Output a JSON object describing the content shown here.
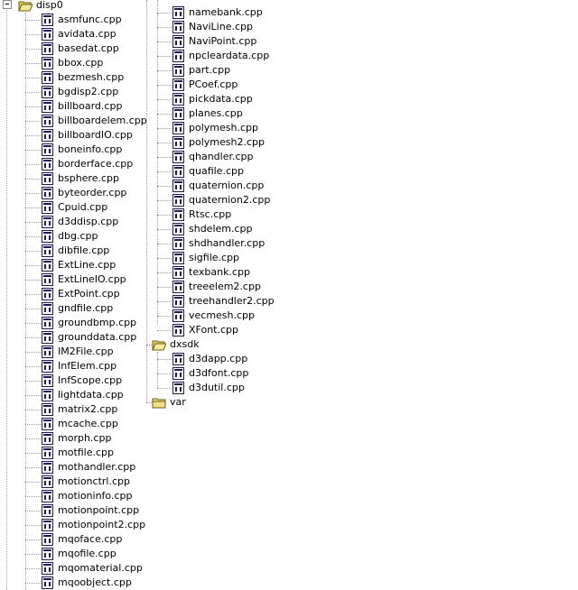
{
  "tree": {
    "root_folder": {
      "label": "disp0",
      "icon": "folder-open-icon"
    },
    "col1_files": [
      "asmfunc.cpp",
      "avidata.cpp",
      "basedat.cpp",
      "bbox.cpp",
      "bezmesh.cpp",
      "bgdisp2.cpp",
      "billboard.cpp",
      "billboardelem.cpp",
      "billboardIO.cpp",
      "boneinfo.cpp",
      "borderface.cpp",
      "bsphere.cpp",
      "byteorder.cpp",
      "Cpuid.cpp",
      "d3ddisp.cpp",
      "dbg.cpp",
      "dibfile.cpp",
      "ExtLine.cpp",
      "ExtLineIO.cpp",
      "ExtPoint.cpp",
      "gndfile.cpp",
      "groundbmp.cpp",
      "grounddata.cpp",
      "IM2File.cpp",
      "InfElem.cpp",
      "InfScope.cpp",
      "lightdata.cpp",
      "matrix2.cpp",
      "mcache.cpp",
      "morph.cpp",
      "motfile.cpp",
      "mothandler.cpp",
      "motionctrl.cpp",
      "motioninfo.cpp",
      "motionpoint.cpp",
      "motionpoint2.cpp",
      "mqoface.cpp",
      "mqofile.cpp",
      "mqomaterial.cpp",
      "mqoobject.cpp"
    ],
    "col2_files": [
      "namebank.cpp",
      "NaviLine.cpp",
      "NaviPoint.cpp",
      "npcleardata.cpp",
      "part.cpp",
      "PCoef.cpp",
      "pickdata.cpp",
      "planes.cpp",
      "polymesh.cpp",
      "polymesh2.cpp",
      "qhandler.cpp",
      "quafile.cpp",
      "quaternion.cpp",
      "quaternion2.cpp",
      "Rtsc.cpp",
      "shdelem.cpp",
      "shdhandler.cpp",
      "sigfile.cpp",
      "texbank.cpp",
      "treeelem2.cpp",
      "treehandler2.cpp",
      "vecmesh.cpp",
      "XFont.cpp"
    ],
    "dxsdk_folder": {
      "label": "dxsdk",
      "icon": "folder-open-icon"
    },
    "dxsdk_files": [
      "d3dapp.cpp",
      "d3dfont.cpp",
      "d3dutil.cpp"
    ],
    "var_folder": {
      "label": "var",
      "icon": "folder-closed-icon"
    }
  },
  "colors": {
    "folder": "#f2e08a",
    "folder_dark": "#7a6a10",
    "file_icon": "#1b1b4e",
    "tree_lines": "#9a9a9a"
  }
}
